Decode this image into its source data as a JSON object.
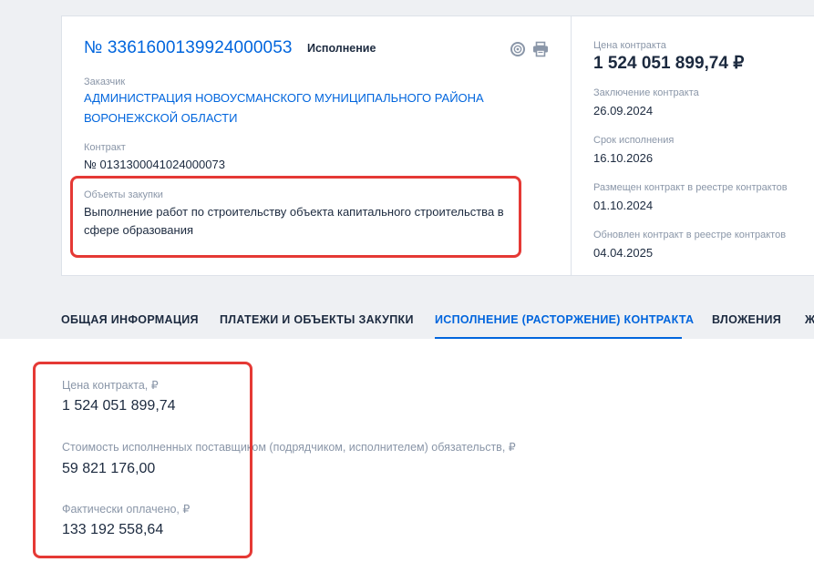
{
  "header": {
    "reg_number": "№ 3361600139924000053",
    "status": "Исполнение"
  },
  "icons": {
    "email": "at-icon",
    "print": "printer-icon"
  },
  "customer": {
    "label": "Заказчик",
    "line1": "АДМИНИСТРАЦИЯ НОВОУСМАНСКОГО МУНИЦИПАЛЬНОГО РАЙОНА",
    "line2": "ВОРОНЕЖСКОЙ ОБЛАСТИ"
  },
  "contract": {
    "label": "Контракт",
    "value": "№ 0131300041024000073"
  },
  "objects": {
    "label": "Объекты закупки",
    "line1": "Выполнение работ по строительству объекта капитального строительства в",
    "line2": "сфере образования"
  },
  "side": {
    "price_label": "Цена контракта",
    "price_value": "1 524 051 899,74 ₽",
    "conclusion_label": "Заключение контракта",
    "conclusion_value": "26.09.2024",
    "term_label": "Срок исполнения",
    "term_value": "16.10.2026",
    "placed_label": "Размещен контракт в реестре контрактов",
    "placed_value": "01.10.2024",
    "updated_label": "Обновлен контракт в реестре контрактов",
    "updated_value": "04.04.2025"
  },
  "tabs": [
    {
      "label": "ОБЩАЯ ИНФОРМАЦИЯ"
    },
    {
      "label": "ПЛАТЕЖИ И ОБЪЕКТЫ ЗАКУПКИ"
    },
    {
      "label": "ИСПОЛНЕНИЕ (РАСТОРЖЕНИЕ) КОНТРАКТА"
    },
    {
      "label": "ВЛОЖЕНИЯ"
    },
    {
      "label": "Ж"
    }
  ],
  "execution": {
    "price_label": "Цена контракта, ₽",
    "price_value": "1 524 051 899,74",
    "fulfilled_label": "Стоимость исполненных поставщиком (подрядчиком, исполнителем) обязательств, ₽",
    "fulfilled_value": "59 821 176,00",
    "paid_label": "Фактически оплачено, ₽",
    "paid_value": "133 192 558,64"
  },
  "colors": {
    "accent": "#0065dd",
    "highlight": "#e53935",
    "background": "#eef0f3"
  }
}
